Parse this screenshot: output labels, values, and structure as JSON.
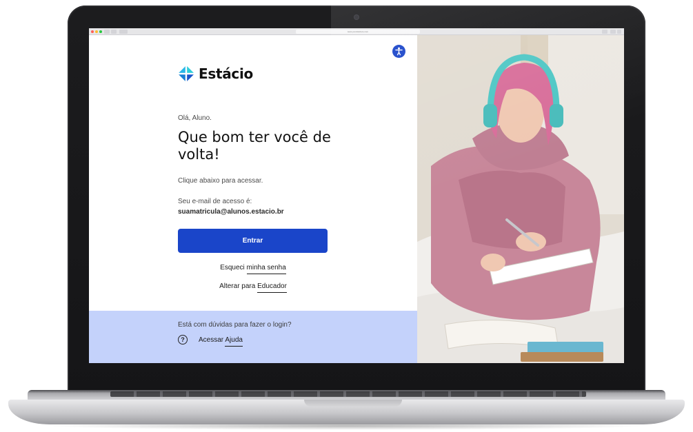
{
  "browser": {
    "url": "www.yoursitehere.com"
  },
  "brand": {
    "name": "Estácio",
    "color": "#1a45c9",
    "help_band_color": "#c4d2fb"
  },
  "accessibility": {
    "icon": "accessibility-icon"
  },
  "login": {
    "greeting": "Olá, Aluno.",
    "headline": "Que bom ter você de volta!",
    "instruction": "Clique abaixo para acessar.",
    "email_label": "Seu e-mail de acesso é:",
    "email_value": "suamatricula@alunos.estacio.br",
    "enter_button": "Entrar",
    "forgot_prefix": "Esqueci ",
    "forgot_link": "minha senha",
    "switch_prefix": "Alterar para ",
    "switch_link": "Educador"
  },
  "help": {
    "question": "Está com dúvidas para fazer o login?",
    "icon": "help-circle-icon",
    "link_prefix": "Acessar ",
    "link": "Ajuda"
  },
  "photo": {
    "subject": "student-with-headphones-photo"
  }
}
